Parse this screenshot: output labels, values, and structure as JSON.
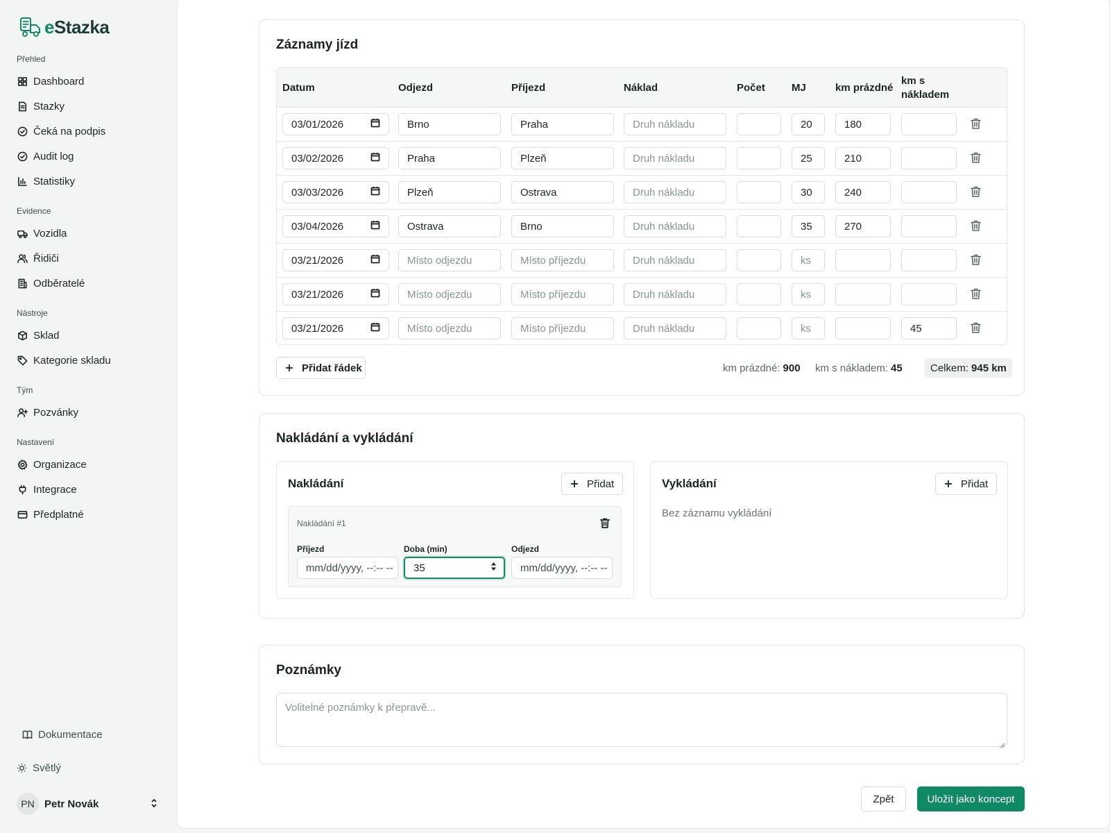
{
  "brand": {
    "logo_prefix": "e",
    "logo_rest": "Stazka",
    "icon": "truck-document-icon",
    "accent": "#0f8a65"
  },
  "sidebar": {
    "sections": [
      {
        "label": "Přehled",
        "items": [
          {
            "label": "Dashboard",
            "icon": "grid-icon"
          },
          {
            "label": "Stazky",
            "icon": "document-icon"
          },
          {
            "label": "Čeká na podpis",
            "icon": "check-circle-icon"
          },
          {
            "label": "Audit log",
            "icon": "check-circle-icon"
          },
          {
            "label": "Statistiky",
            "icon": "bar-chart-icon"
          }
        ]
      },
      {
        "label": "Evidence",
        "items": [
          {
            "label": "Vozidla",
            "icon": "truck-icon"
          },
          {
            "label": "Řidiči",
            "icon": "users-icon"
          },
          {
            "label": "Odběratelé",
            "icon": "building-icon"
          }
        ]
      },
      {
        "label": "Nástroje",
        "items": [
          {
            "label": "Sklad",
            "icon": "box-icon"
          },
          {
            "label": "Kategorie skladu",
            "icon": "tag-icon"
          }
        ]
      },
      {
        "label": "Tým",
        "items": [
          {
            "label": "Pozvánky",
            "icon": "user-plus-icon"
          }
        ]
      },
      {
        "label": "Nastavení",
        "items": [
          {
            "label": "Organizace",
            "icon": "gear-icon"
          },
          {
            "label": "Integrace",
            "icon": "plug-icon"
          },
          {
            "label": "Předplatné",
            "icon": "credit-card-icon"
          }
        ]
      }
    ],
    "docs_label": "Dokumentace",
    "theme_label": "Světlý",
    "user": {
      "initials": "PN",
      "name": "Petr Novák"
    }
  },
  "trips": {
    "title": "Záznamy jízd",
    "columns": [
      "Datum",
      "Odjezd",
      "Příjezd",
      "Náklad",
      "Počet",
      "MJ",
      "km prázdné",
      "km s nákladem"
    ],
    "placeholders": {
      "odjezd": "Místo odjezdu",
      "prijezd": "Místo příjezdu",
      "naklad": "Druh nákladu",
      "mj": "ks"
    },
    "rows": [
      {
        "datum": "03/01/2026",
        "odjezd": "Brno",
        "prijezd": "Praha",
        "naklad": "",
        "pocet": "",
        "mj": "20",
        "km_prazdne": "180",
        "km_naklad": ""
      },
      {
        "datum": "03/02/2026",
        "odjezd": "Praha",
        "prijezd": "Plzeň",
        "naklad": "",
        "pocet": "",
        "mj": "25",
        "km_prazdne": "210",
        "km_naklad": ""
      },
      {
        "datum": "03/03/2026",
        "odjezd": "Plzeň",
        "prijezd": "Ostrava",
        "naklad": "",
        "pocet": "",
        "mj": "30",
        "km_prazdne": "240",
        "km_naklad": ""
      },
      {
        "datum": "03/04/2026",
        "odjezd": "Ostrava",
        "prijezd": "Brno",
        "naklad": "",
        "pocet": "",
        "mj": "35",
        "km_prazdne": "270",
        "km_naklad": ""
      },
      {
        "datum": "03/21/2026",
        "odjezd": "",
        "prijezd": "",
        "naklad": "",
        "pocet": "",
        "mj": "",
        "km_prazdne": "",
        "km_naklad": ""
      },
      {
        "datum": "03/21/2026",
        "odjezd": "",
        "prijezd": "",
        "naklad": "",
        "pocet": "",
        "mj": "",
        "km_prazdne": "",
        "km_naklad": ""
      },
      {
        "datum": "03/21/2026",
        "odjezd": "",
        "prijezd": "",
        "naklad": "",
        "pocet": "",
        "mj": "",
        "km_prazdne": "",
        "km_naklad": "45"
      }
    ],
    "add_row_label": "Přidat řádek",
    "summary": {
      "km_prazdne_label": "km prázdné:",
      "km_prazdne_value": "900",
      "km_naklad_label": "km s nákladem:",
      "km_naklad_value": "45",
      "total_label": "Celkem:",
      "total_value": "945 km"
    }
  },
  "loading": {
    "title": "Nakládání a vykládání",
    "loading_panel": {
      "title": "Nakládání",
      "add_label": "Přidat",
      "entry": {
        "title": "Nakládání #1",
        "fields": [
          {
            "label": "Příjezd",
            "value": "mm/dd/yyyy, --:-- --"
          },
          {
            "label": "Doba (min)",
            "value": "35"
          },
          {
            "label": "Odjezd",
            "value": "mm/dd/yyyy, --:-- --"
          }
        ]
      }
    },
    "unloading_panel": {
      "title": "Vykládání",
      "add_label": "Přidat",
      "empty_text": "Bez záznamu vykládání"
    }
  },
  "notes": {
    "title": "Poznámky",
    "placeholder": "Volitelné poznámky k přepravě..."
  },
  "actions": {
    "back_label": "Zpět",
    "save_label": "Uložit jako koncept"
  }
}
